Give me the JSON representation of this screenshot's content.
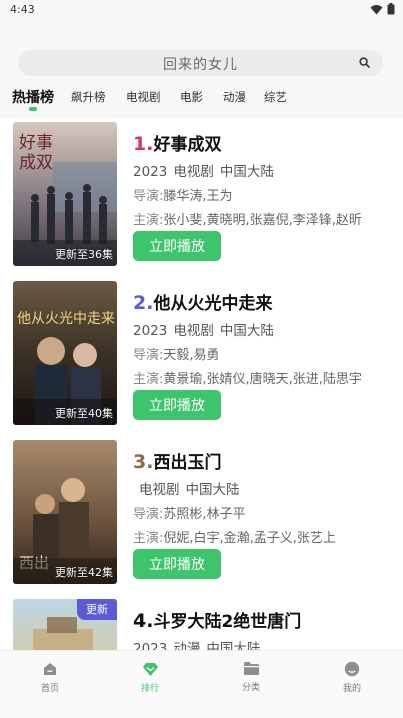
{
  "status": {
    "time": "4:43"
  },
  "search": {
    "placeholder": "回来的女儿"
  },
  "tabs": [
    {
      "label": "热播榜",
      "active": true
    },
    {
      "label": "飙升榜"
    },
    {
      "label": "电视剧"
    },
    {
      "label": "电影"
    },
    {
      "label": "动漫"
    },
    {
      "label": "综艺"
    }
  ],
  "items": [
    {
      "rank": "1.",
      "title": "好事成双",
      "year": "2023",
      "genre": "电视剧",
      "region": "中国大陆",
      "director_label": "导演:",
      "director": "滕华涛,王为",
      "cast_label": "主演:",
      "cast": "张小斐,黄晓明,张嘉倪,李泽锋,赵昕",
      "badge": "更新至36集",
      "play_label": "立即播放",
      "rank_color": "#d6336c"
    },
    {
      "rank": "2.",
      "title": "他从火光中走来",
      "year": "2023",
      "genre": "电视剧",
      "region": "中国大陆",
      "director_label": "导演:",
      "director": "天毅,易勇",
      "cast_label": "主演:",
      "cast": "黄景瑜,张婧仪,唐晓天,张进,陆思宇",
      "badge": "更新至40集",
      "play_label": "立即播放",
      "rank_color": "#5b5bd6"
    },
    {
      "rank": "3.",
      "title": "西出玉门",
      "year": "",
      "genre": "电视剧",
      "region": "中国大陆",
      "director_label": "导演:",
      "director": "苏照彬,林子平",
      "cast_label": "主演:",
      "cast": "倪妮,白宇,金瀚,孟子义,张艺上",
      "badge": "更新至42集",
      "play_label": "立即播放",
      "rank_color": "#8a6a4a"
    },
    {
      "rank": "4.",
      "title": "斗罗大陆2绝世唐门",
      "year": "2023",
      "genre": "动漫",
      "region": "中国大陆",
      "corner_tag": "更新",
      "rank_color": "#111111"
    }
  ],
  "nav": [
    {
      "label": "首页",
      "icon": "home-icon"
    },
    {
      "label": "排行",
      "icon": "ranking-icon",
      "active": true
    },
    {
      "label": "分类",
      "icon": "folder-icon"
    },
    {
      "label": "我的",
      "icon": "profile-icon"
    }
  ],
  "colors": {
    "accent": "#3ec46d",
    "tag": "#5b5bd6"
  }
}
